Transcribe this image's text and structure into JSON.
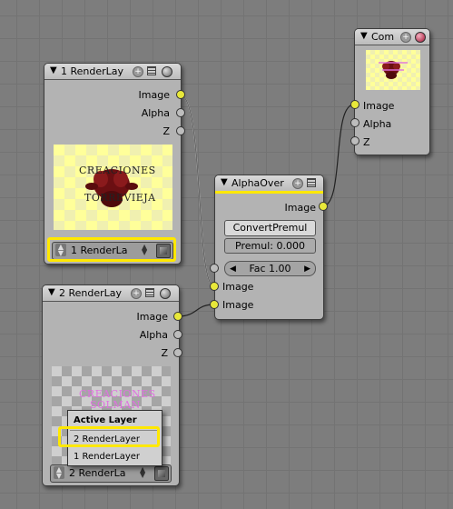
{
  "node_render1": {
    "title": "1 RenderLay",
    "outputs": [
      "Image",
      "Alpha",
      "Z"
    ],
    "preview_text": [
      "CREACIONES",
      "TORREVIEJA"
    ],
    "layer_select": "1 RenderLa"
  },
  "node_render2": {
    "title": "2 RenderLay",
    "outputs": [
      "Image",
      "Alpha",
      "Z"
    ],
    "preview_text": [
      "CREACIONES",
      "SOLMAN"
    ],
    "layer_select": "2 RenderLa",
    "menu": {
      "title": "Active Layer",
      "items": [
        "2 RenderLayer",
        "1 RenderLayer"
      ]
    }
  },
  "node_alphaover": {
    "title": "AlphaOver",
    "output": "Image",
    "convert_button": "ConvertPremul",
    "premul": "Premul: 0.000",
    "fac": "Fac 1.00",
    "inputs": [
      "Image",
      "Image"
    ]
  },
  "node_composite": {
    "title": "Com",
    "inputs": [
      "Image",
      "Alpha",
      "Z"
    ]
  },
  "colors": {
    "socket_image": "#e8e83a",
    "socket_value": "#bdbdbd",
    "highlight": "#ffe800",
    "grid_background": "#7d7d7d"
  }
}
